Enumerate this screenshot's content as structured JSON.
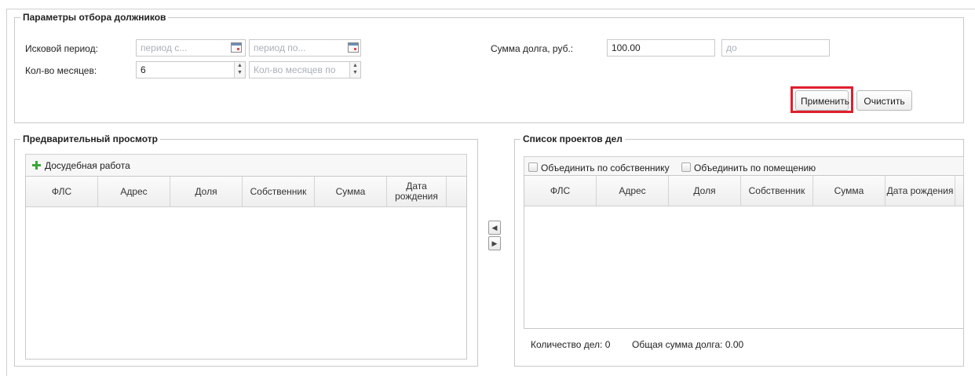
{
  "filter": {
    "legend": "Параметры отбора должников",
    "period_label": "Исковой период:",
    "period_from_placeholder": "период с...",
    "period_to_placeholder": "период по...",
    "months_label": "Кол-во месяцев:",
    "months_value": "6",
    "months_to_placeholder": "Кол-во месяцев по",
    "debt_label": "Сумма долга, руб.:",
    "debt_from_value": "100.00",
    "debt_to_placeholder": "до",
    "apply_label": "Применить",
    "clear_label": "Очистить"
  },
  "preview": {
    "legend": "Предварительный просмотр",
    "toolbar_label": "Досудебная работа",
    "columns": [
      "ФЛС",
      "Адрес",
      "Доля",
      "Собственник",
      "Сумма",
      "Дата рождения"
    ]
  },
  "projects": {
    "legend": "Список проектов дел",
    "merge_owner_label": "Объединить по собственнику",
    "merge_room_label": "Объединить по помещению",
    "columns": [
      "ФЛС",
      "Адрес",
      "Доля",
      "Собственник",
      "Сумма",
      "Дата рождения"
    ],
    "count_text": "Количество дел: 0",
    "total_text": "Общая сумма долга: 0.00"
  },
  "colors": {
    "highlight": "#e01f2d",
    "add_icon": "#3aa73a"
  },
  "icons": {
    "calendar": "calendar-icon",
    "spinner": "spinner-icon",
    "add": "plus-icon",
    "move_left": "arrow-left-icon",
    "move_right": "arrow-right-icon"
  }
}
